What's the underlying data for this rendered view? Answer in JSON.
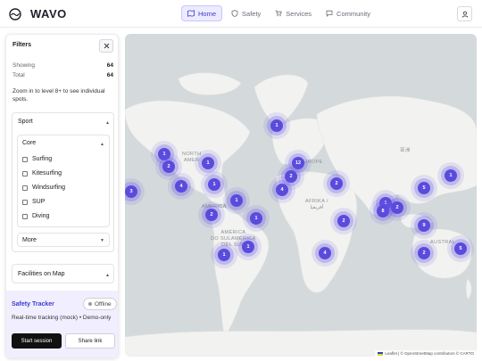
{
  "app": {
    "logo_text": "WAVO"
  },
  "nav": [
    {
      "label": "Home",
      "active": true,
      "icon": "map-icon"
    },
    {
      "label": "Safety",
      "active": false,
      "icon": "shield-icon"
    },
    {
      "label": "Services",
      "active": false,
      "icon": "cart-icon"
    },
    {
      "label": "Community",
      "active": false,
      "icon": "chat-icon"
    }
  ],
  "filters": {
    "title": "Filters",
    "showing_label": "Showing",
    "showing_value": "64",
    "total_label": "Total",
    "total_value": "64",
    "hint": "Zoom in to level 8+ to see individual spots.",
    "sport_label": "Sport",
    "core_label": "Core",
    "core_items": [
      "Surfing",
      "Kitesurfing",
      "Windsurfing",
      "SUP",
      "Diving"
    ],
    "more_label": "More",
    "facilities_label": "Facilities on Map"
  },
  "tracker": {
    "title": "Safety Tracker",
    "status": "Offline",
    "description": "Real-time tracking (mock) • Demo-only",
    "start_label": "Start session",
    "share_label": "Share link"
  },
  "map": {
    "labels": {
      "north_america": "NORTH\nAMER",
      "europe": "EUROPE",
      "africa": "AFRIKA /\nأفريقيا",
      "america": "AMERICA",
      "south_america": "AMÉRICA\nDO SULAMÉRICA\nDEL SUR",
      "australia": "AUSTRAL",
      "china": "亚洲"
    },
    "clusters": [
      "1",
      "1",
      "2",
      "3",
      "4",
      "1",
      "1",
      "1",
      "2",
      "1",
      "1",
      "1",
      "12",
      "2",
      "4",
      "2",
      "2",
      "4",
      "1",
      "8",
      "2",
      "1",
      "5",
      "9",
      "2",
      "5"
    ],
    "attribution": "Leaflet | © OpenStreetMap contributors © CARTO"
  },
  "colors": {
    "accent": "#5a4bdd",
    "nav_active_bg": "#ecebff",
    "tracker_bg": "#f1efff",
    "map_water": "#d4dadc",
    "map_land": "#f2f2f0"
  }
}
